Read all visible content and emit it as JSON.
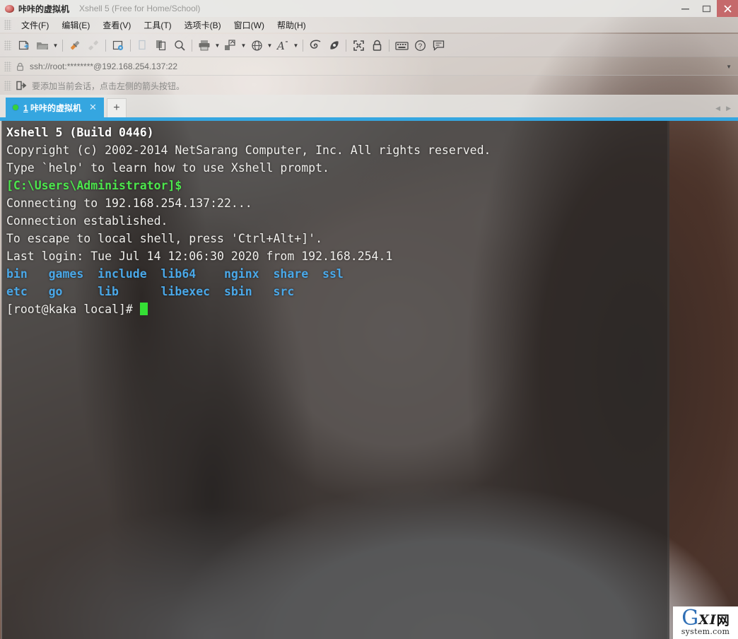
{
  "window": {
    "app_icon": "xshell-logo-icon",
    "title": "咔咔的虚拟机",
    "subtitle": "Xshell 5 (Free for Home/School)",
    "minimize_label": "—",
    "maximize_label": "□",
    "close_label": "✕",
    "close_color": "#c5696b"
  },
  "menubar": {
    "items": [
      {
        "label": "文件(F)",
        "name": "menu-file"
      },
      {
        "label": "编辑(E)",
        "name": "menu-edit"
      },
      {
        "label": "查看(V)",
        "name": "menu-view"
      },
      {
        "label": "工具(T)",
        "name": "menu-tools"
      },
      {
        "label": "选项卡(B)",
        "name": "menu-tabs"
      },
      {
        "label": "窗口(W)",
        "name": "menu-window"
      },
      {
        "label": "帮助(H)",
        "name": "menu-help"
      }
    ]
  },
  "toolbar": {
    "items": [
      {
        "icon": "new-session-icon",
        "caret": false
      },
      {
        "icon": "open-folder-icon",
        "caret": true
      },
      {
        "sep": true
      },
      {
        "icon": "connect-icon",
        "caret": false
      },
      {
        "icon": "disconnect-icon",
        "caret": false,
        "disabled": true
      },
      {
        "sep": true
      },
      {
        "icon": "session-properties-icon",
        "caret": false
      },
      {
        "sep": true
      },
      {
        "icon": "cut-icon",
        "caret": false,
        "disabled": true
      },
      {
        "icon": "copy-paste-icon",
        "caret": false
      },
      {
        "icon": "find-icon",
        "caret": false
      },
      {
        "sep": true
      },
      {
        "icon": "print-icon",
        "caret": true
      },
      {
        "icon": "transfer-file-icon",
        "caret": true
      },
      {
        "icon": "globe-encoding-icon",
        "caret": true
      },
      {
        "icon": "font-icon",
        "caret": true
      },
      {
        "sep": true
      },
      {
        "icon": "compose-bar-icon",
        "caret": false
      },
      {
        "icon": "highlight-icon",
        "caret": false
      },
      {
        "sep": true
      },
      {
        "icon": "fullscreen-icon",
        "caret": false
      },
      {
        "icon": "lock-icon",
        "caret": false
      },
      {
        "sep": true
      },
      {
        "icon": "keyboard-icon",
        "caret": false
      },
      {
        "icon": "help-icon",
        "caret": false
      },
      {
        "icon": "feedback-icon",
        "caret": false
      }
    ]
  },
  "addressbar": {
    "lock_icon": "lock-icon",
    "value": "ssh://root:********@192.168.254.137:22",
    "placeholder": "ssh://root:********@192.168.254.137:22",
    "dropdown_icon": "chevron-down-icon"
  },
  "notice": {
    "icon": "add-session-arrow-icon",
    "text": "要添加当前会话，点击左侧的箭头按钮。"
  },
  "tabs": {
    "active": {
      "status_dot": "connected-dot-icon",
      "index": "1",
      "label": "咔咔的虚拟机",
      "close_label": "✕"
    },
    "new_tab_label": "+",
    "nav_prev": "◀",
    "nav_next": "▶",
    "accent_color": "#35a6e0"
  },
  "terminal": {
    "colors": {
      "background": "rgba(40,40,40,0.74)",
      "foreground": "#e2e2de",
      "green": "#4ce64c",
      "blue": "#4aa8e8",
      "cursor": "#35e035"
    },
    "lines": [
      {
        "segs": [
          {
            "t": "Xshell 5 (Build 0446)",
            "c": "bold"
          }
        ]
      },
      {
        "segs": [
          {
            "t": "Copyright (c) 2002-2014 NetSarang Computer, Inc. All rights reserved.",
            "c": "white"
          }
        ]
      },
      {
        "segs": [
          {
            "t": "",
            "c": "white"
          }
        ]
      },
      {
        "segs": [
          {
            "t": "Type `help' to learn how to use Xshell prompt.",
            "c": "white"
          }
        ]
      },
      {
        "segs": [
          {
            "t": "[C:\\Users\\Administrator]$",
            "c": "green"
          }
        ]
      },
      {
        "segs": [
          {
            "t": "",
            "c": "white"
          }
        ]
      },
      {
        "segs": [
          {
            "t": "Connecting to 192.168.254.137:22...",
            "c": "white"
          }
        ]
      },
      {
        "segs": [
          {
            "t": "Connection established.",
            "c": "white"
          }
        ]
      },
      {
        "segs": [
          {
            "t": "To escape to local shell, press 'Ctrl+Alt+]'.",
            "c": "white"
          }
        ]
      },
      {
        "segs": [
          {
            "t": "",
            "c": "white"
          }
        ]
      },
      {
        "segs": [
          {
            "t": "Last login: Tue Jul 14 12:06:30 2020 from 192.168.254.1",
            "c": "white"
          }
        ]
      },
      {
        "segs": [
          {
            "t": "bin   games  include  lib64    nginx  share  ssl",
            "c": "blue"
          }
        ]
      },
      {
        "segs": [
          {
            "t": "etc   go     lib      libexec  sbin   src",
            "c": "blue"
          }
        ]
      },
      {
        "segs": [
          {
            "t": "[root@kaka local]# ",
            "c": "white"
          },
          {
            "t": "",
            "c": "cursor"
          }
        ]
      }
    ]
  },
  "watermark": {
    "letter_g": "G",
    "letters_xi": "XI",
    "char_net": "网",
    "domain": "system.com"
  }
}
